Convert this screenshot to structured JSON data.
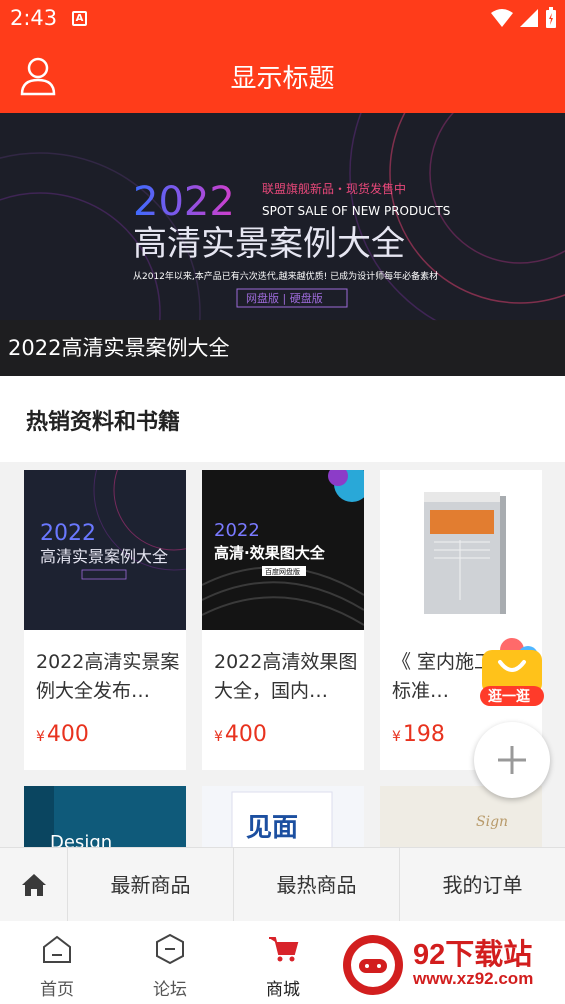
{
  "status": {
    "time": "2:43",
    "notif_letter": "A"
  },
  "appbar": {
    "title": "显示标题"
  },
  "banner": {
    "year": "2022",
    "tag": "联盟旗舰新品・现货发售中",
    "subtitle_en": "SPOT SALE OF NEW PRODUCTS",
    "headline": "高清实景案例大全",
    "desc": "从2012年以来,本产品已有六次迭代,越来越优质! 已成为设计师每年必备素材",
    "badge": "网盘版 | 硬盘版",
    "caption": "2022高清实景案例大全"
  },
  "section": {
    "title": "热销资料和书籍"
  },
  "products": [
    {
      "name": "2022高清实景案例大全发布…",
      "price": "400",
      "cover_year": "2022",
      "cover_title": "高清实景案例大全"
    },
    {
      "name": "2022高清效果图大全，国内…",
      "price": "400",
      "cover_year": "2022",
      "cover_title": "高清·效果图大全",
      "cover_badge": "百度网盘版"
    },
    {
      "name": "《 室内施工规范标准…",
      "price": "198"
    }
  ],
  "currency": "¥",
  "row2": [
    {
      "cover_text": "Design"
    },
    {
      "cover_text": "见面"
    },
    {
      "cover_text": "Sign"
    }
  ],
  "fab": {
    "shop_label": "逛一逛"
  },
  "menu": {
    "items": [
      "最新商品",
      "最热商品",
      "我的订单"
    ]
  },
  "tabs": [
    {
      "label": "首页",
      "icon": "home-outline-icon"
    },
    {
      "label": "论坛",
      "icon": "forum-icon"
    },
    {
      "label": "商城",
      "icon": "cart-icon"
    }
  ],
  "watermark": {
    "brand": "92下载站",
    "url": "www.xz92.com"
  },
  "colors": {
    "accent": "#ff3c1a",
    "price": "#e8321e"
  }
}
